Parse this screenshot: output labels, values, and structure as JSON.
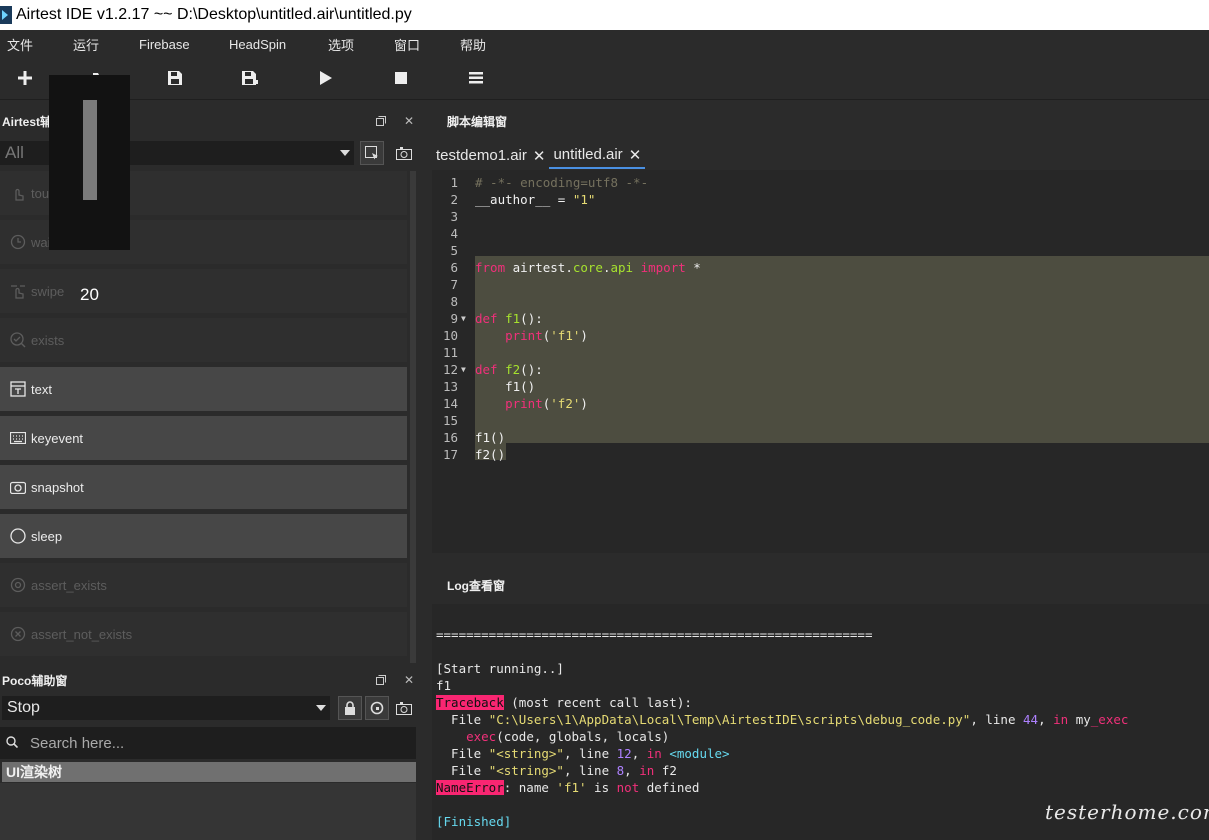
{
  "window": {
    "title": "Airtest IDE v1.2.17 ~~ D:\\Desktop\\untitled.air\\untitled.py"
  },
  "menu": [
    "文件",
    "运行",
    "Firebase",
    "HeadSpin",
    "选项",
    "窗口",
    "帮助"
  ],
  "toolbar": [
    "new-icon",
    "open-icon",
    "save-icon",
    "save-as-icon",
    "play-icon",
    "stop-icon",
    "log-icon"
  ],
  "airtest_panel": {
    "title": "Airtest辅助窗",
    "filter_value": "All",
    "items": [
      {
        "label": "touch",
        "icon": "touch-icon",
        "enabled": false
      },
      {
        "label": "wait",
        "icon": "clock-icon",
        "enabled": false
      },
      {
        "label": "swipe",
        "icon": "swipe-icon",
        "enabled": false
      },
      {
        "label": "exists",
        "icon": "check-search-icon",
        "enabled": false
      },
      {
        "label": "text",
        "icon": "text-icon",
        "enabled": true
      },
      {
        "label": "keyevent",
        "icon": "keyboard-icon",
        "enabled": true
      },
      {
        "label": "snapshot",
        "icon": "camera-icon",
        "enabled": true
      },
      {
        "label": "sleep",
        "icon": "moon-icon",
        "enabled": true
      },
      {
        "label": "assert_exists",
        "icon": "target-icon",
        "enabled": false
      },
      {
        "label": "assert_not_exists",
        "icon": "target-x-icon",
        "enabled": false
      }
    ]
  },
  "volume_popup": {
    "value": "20",
    "level_percent": 20
  },
  "poco_panel": {
    "title": "Poco辅助窗",
    "mode_value": "Stop",
    "search_placeholder": "Search here...",
    "tree_root": "UI渲染树"
  },
  "editor": {
    "title": "脚本编辑窗",
    "tabs": [
      {
        "label": "testdemo1.air",
        "active": false
      },
      {
        "label": "untitled.air",
        "active": true
      }
    ],
    "lines": [
      {
        "n": "1",
        "fold": "",
        "html": "<span class='cm'># -*- encoding=utf8 -*-</span>"
      },
      {
        "n": "2",
        "fold": "",
        "html": "__author__ = <span class='str'>\"1\"</span>"
      },
      {
        "n": "3",
        "fold": "",
        "html": ""
      },
      {
        "n": "4",
        "fold": "",
        "html": ""
      },
      {
        "n": "5",
        "fold": "",
        "html": ""
      },
      {
        "n": "6",
        "fold": "",
        "html": "<span class='kw'>from</span> airtest.<span class='fn'>core</span>.<span class='fn'>api</span> <span class='kw'>import</span> *"
      },
      {
        "n": "7",
        "fold": "",
        "html": ""
      },
      {
        "n": "8",
        "fold": "",
        "html": ""
      },
      {
        "n": "9",
        "fold": "▼",
        "html": "<span class='kw'>def</span> <span class='fn'>f1</span>():"
      },
      {
        "n": "10",
        "fold": "",
        "html": "    <span class='kw'>print</span>(<span class='str'>'f1'</span>)"
      },
      {
        "n": "11",
        "fold": "",
        "html": ""
      },
      {
        "n": "12",
        "fold": "▼",
        "html": "<span class='kw'>def</span> <span class='fn'>f2</span>():"
      },
      {
        "n": "13",
        "fold": "",
        "html": "    f1()"
      },
      {
        "n": "14",
        "fold": "",
        "html": "    <span class='kw'>print</span>(<span class='str'>'f2'</span>)"
      },
      {
        "n": "15",
        "fold": "",
        "html": ""
      },
      {
        "n": "16",
        "fold": "",
        "html": "f1()"
      },
      {
        "n": "17",
        "fold": "",
        "html": "f2()"
      }
    ]
  },
  "log": {
    "title": "Log查看窗",
    "lines": [
      {
        "html": "=========================================================="
      },
      {
        "html": ""
      },
      {
        "html": "[Start running..]"
      },
      {
        "html": "f1"
      },
      {
        "html": "<span class='err-bg'>Traceback</span> (most recent call last):"
      },
      {
        "html": "  File <span class='path'>\"C:\\Users\\1\\AppData\\Local\\Temp\\AirtestIDE\\scripts\\debug_code.py\"</span>, line <span class='num'>44</span>, <span class='kw'>in</span> my<span class='kw'>_exec</span>"
      },
      {
        "html": "    <span class='kw'>exec</span>(code, globals, locals)"
      },
      {
        "html": "  File <span class='path'>\"&lt;string&gt;\"</span>, line <span class='num'>12</span>, <span class='kw'>in</span> <span class='cyan'>&lt;module&gt;</span>"
      },
      {
        "html": "  File <span class='path'>\"&lt;string&gt;\"</span>, line <span class='num'>8</span>, <span class='kw'>in</span> f2"
      },
      {
        "html": "<span class='err-bg'>NameError</span>: name <span class='str'>'f1'</span> is <span class='kw'>not</span> defined"
      },
      {
        "html": ""
      },
      {
        "html": "<span class='cyan'>[Finished]</span>"
      }
    ]
  },
  "watermark": "testerhome.com"
}
